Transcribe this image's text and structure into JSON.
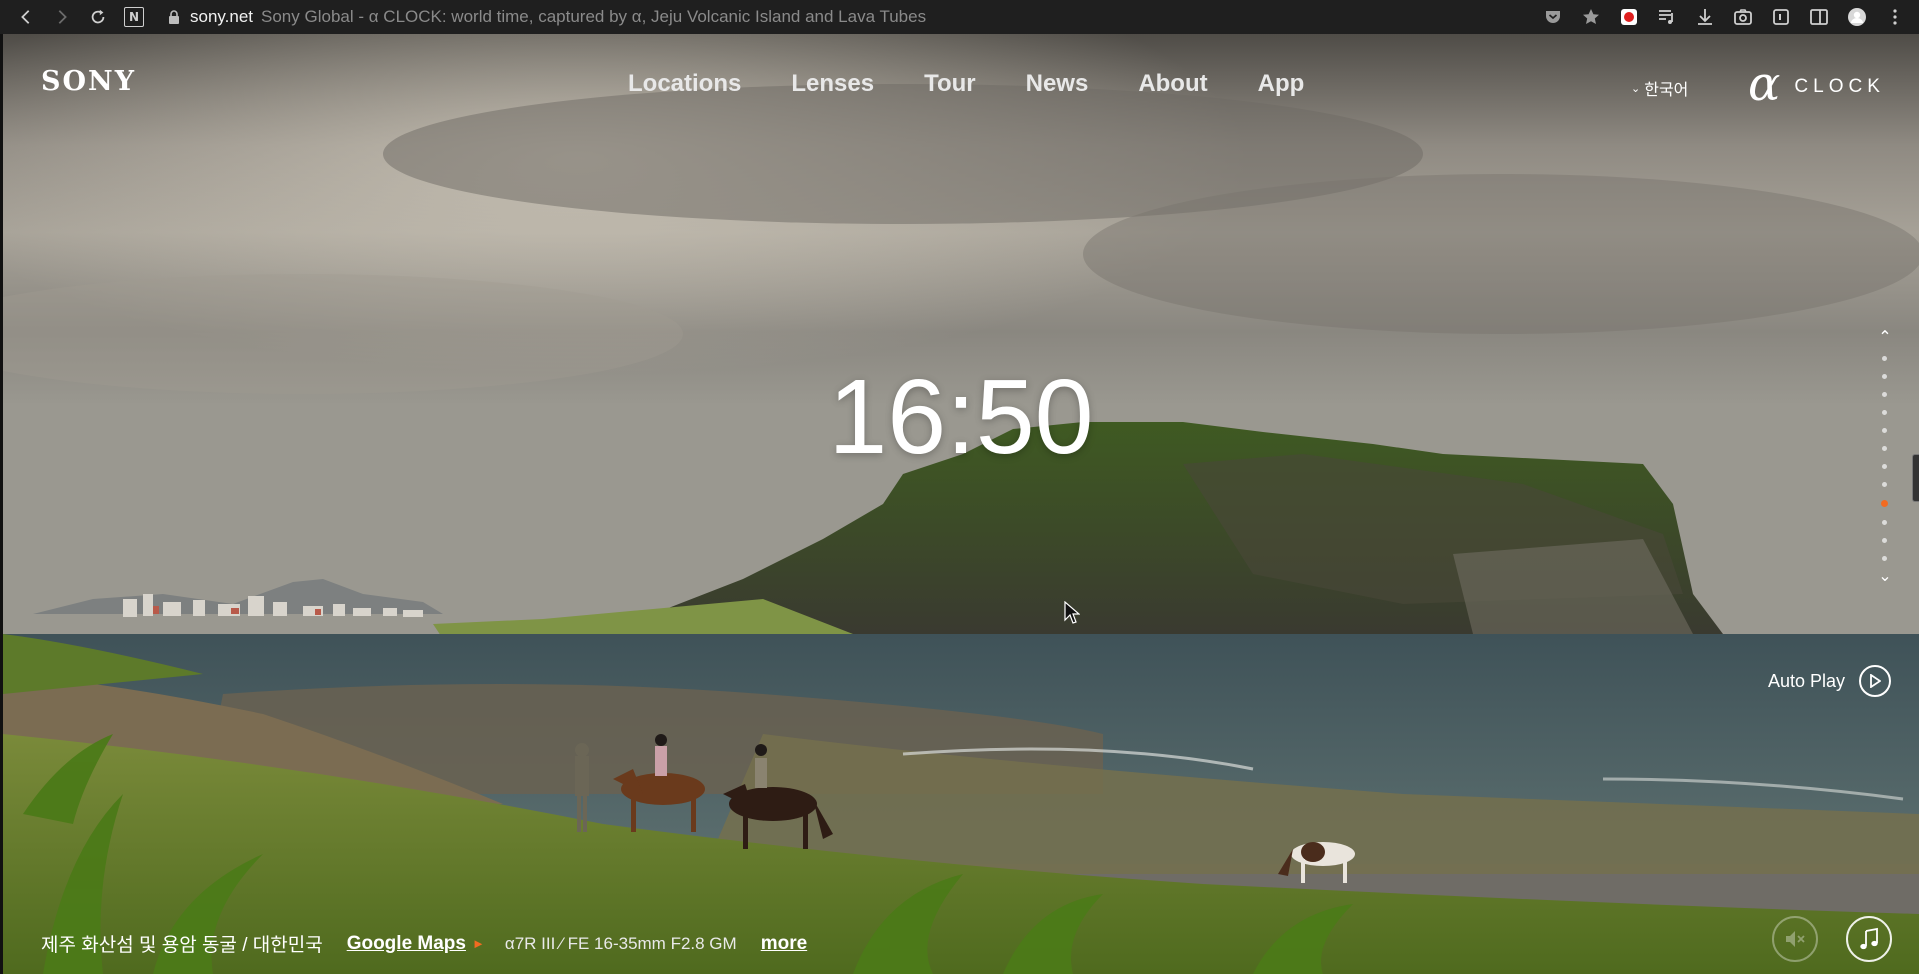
{
  "browser": {
    "host": "sony.net",
    "page_title": "Sony Global - α CLOCK: world time, captured by α, Jeju Volcanic Island and Lava Tubes"
  },
  "header": {
    "logo": "SONY",
    "nav": [
      "Locations",
      "Lenses",
      "Tour",
      "News",
      "About",
      "App"
    ],
    "language": "한국어",
    "brand_alpha": "α",
    "brand_clock": "CLOCK"
  },
  "clock": {
    "time": "16:50"
  },
  "pager": {
    "total": 12,
    "active_index": 8
  },
  "autoplay": {
    "label": "Auto Play"
  },
  "footer": {
    "location": "제주 화산섬 및 용암 동굴 / 대한민국",
    "maps_link": "Google Maps",
    "camera": "α7R III ⁄ FE 16-35mm F2.8 GM",
    "more_link": "more"
  },
  "colors": {
    "accent": "#f26b21"
  }
}
